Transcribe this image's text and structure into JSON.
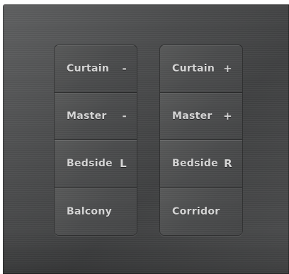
{
  "panel": {
    "left_column": [
      {
        "label": "Curtain",
        "sign": "-"
      },
      {
        "label": "Master",
        "sign": "-"
      },
      {
        "label": "Bedside",
        "sign": "L"
      },
      {
        "label": "Balcony",
        "sign": ""
      }
    ],
    "right_column": [
      {
        "label": "Curtain",
        "sign": "+"
      },
      {
        "label": "Master",
        "sign": "+"
      },
      {
        "label": "Bedside",
        "sign": "R"
      },
      {
        "label": "Corridor",
        "sign": ""
      }
    ],
    "colors": {
      "plate": "#4a4b4c",
      "text": "#d4d4d4"
    }
  }
}
